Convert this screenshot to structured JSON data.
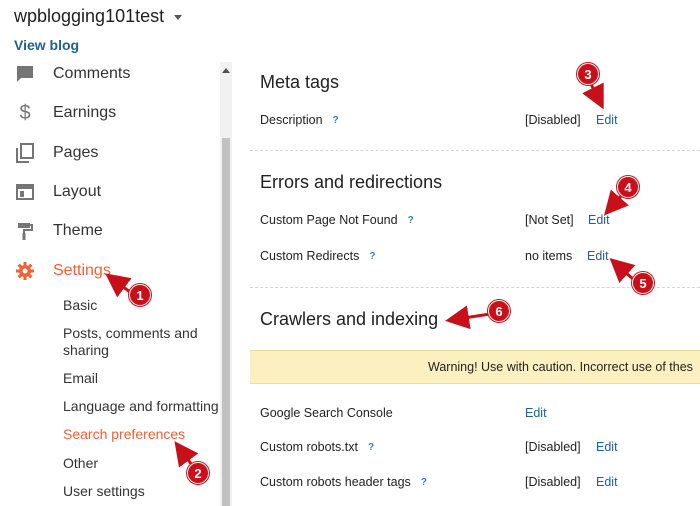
{
  "header": {
    "blog_name": "wpblogging101test",
    "view_blog": "View blog"
  },
  "sidebar": {
    "items": [
      {
        "label": "Comments",
        "icon": "comment-icon"
      },
      {
        "label": "Earnings",
        "icon": "dollar-icon"
      },
      {
        "label": "Pages",
        "icon": "pages-icon"
      },
      {
        "label": "Layout",
        "icon": "layout-icon"
      },
      {
        "label": "Theme",
        "icon": "paint-roller-icon"
      },
      {
        "label": "Settings",
        "icon": "gear-icon",
        "active": true
      }
    ],
    "settings_sub": [
      {
        "label": "Basic"
      },
      {
        "label": "Posts, comments and sharing"
      },
      {
        "label": "Email"
      },
      {
        "label": "Language and formatting"
      },
      {
        "label": "Search preferences",
        "active": true
      },
      {
        "label": "Other"
      },
      {
        "label": "User settings"
      }
    ],
    "active_color": "#f06135"
  },
  "main": {
    "meta_tags": {
      "title": "Meta tags",
      "description": {
        "label": "Description",
        "help": "?",
        "value": "[Disabled]",
        "action": "Edit"
      }
    },
    "errors": {
      "title": "Errors and redirections",
      "not_found": {
        "label": "Custom Page Not Found",
        "help": "?",
        "value": "[Not Set]",
        "action": "Edit"
      },
      "redirects": {
        "label": "Custom Redirects",
        "help": "?",
        "value": "no items",
        "action": "Edit"
      }
    },
    "crawlers": {
      "title": "Crawlers and indexing",
      "warning": "Warning! Use with caution. Incorrect use of thes",
      "search_console": {
        "label": "Google Search Console",
        "action": "Edit"
      },
      "robots_txt": {
        "label": "Custom robots.txt",
        "help": "?",
        "value": "[Disabled]",
        "action": "Edit"
      },
      "robots_header": {
        "label": "Custom robots header tags",
        "help": "?",
        "value": "[Disabled]",
        "action": "Edit"
      }
    }
  },
  "annotations": {
    "badges": [
      "1",
      "2",
      "3",
      "4",
      "5",
      "6"
    ],
    "color": "#c8101a"
  }
}
